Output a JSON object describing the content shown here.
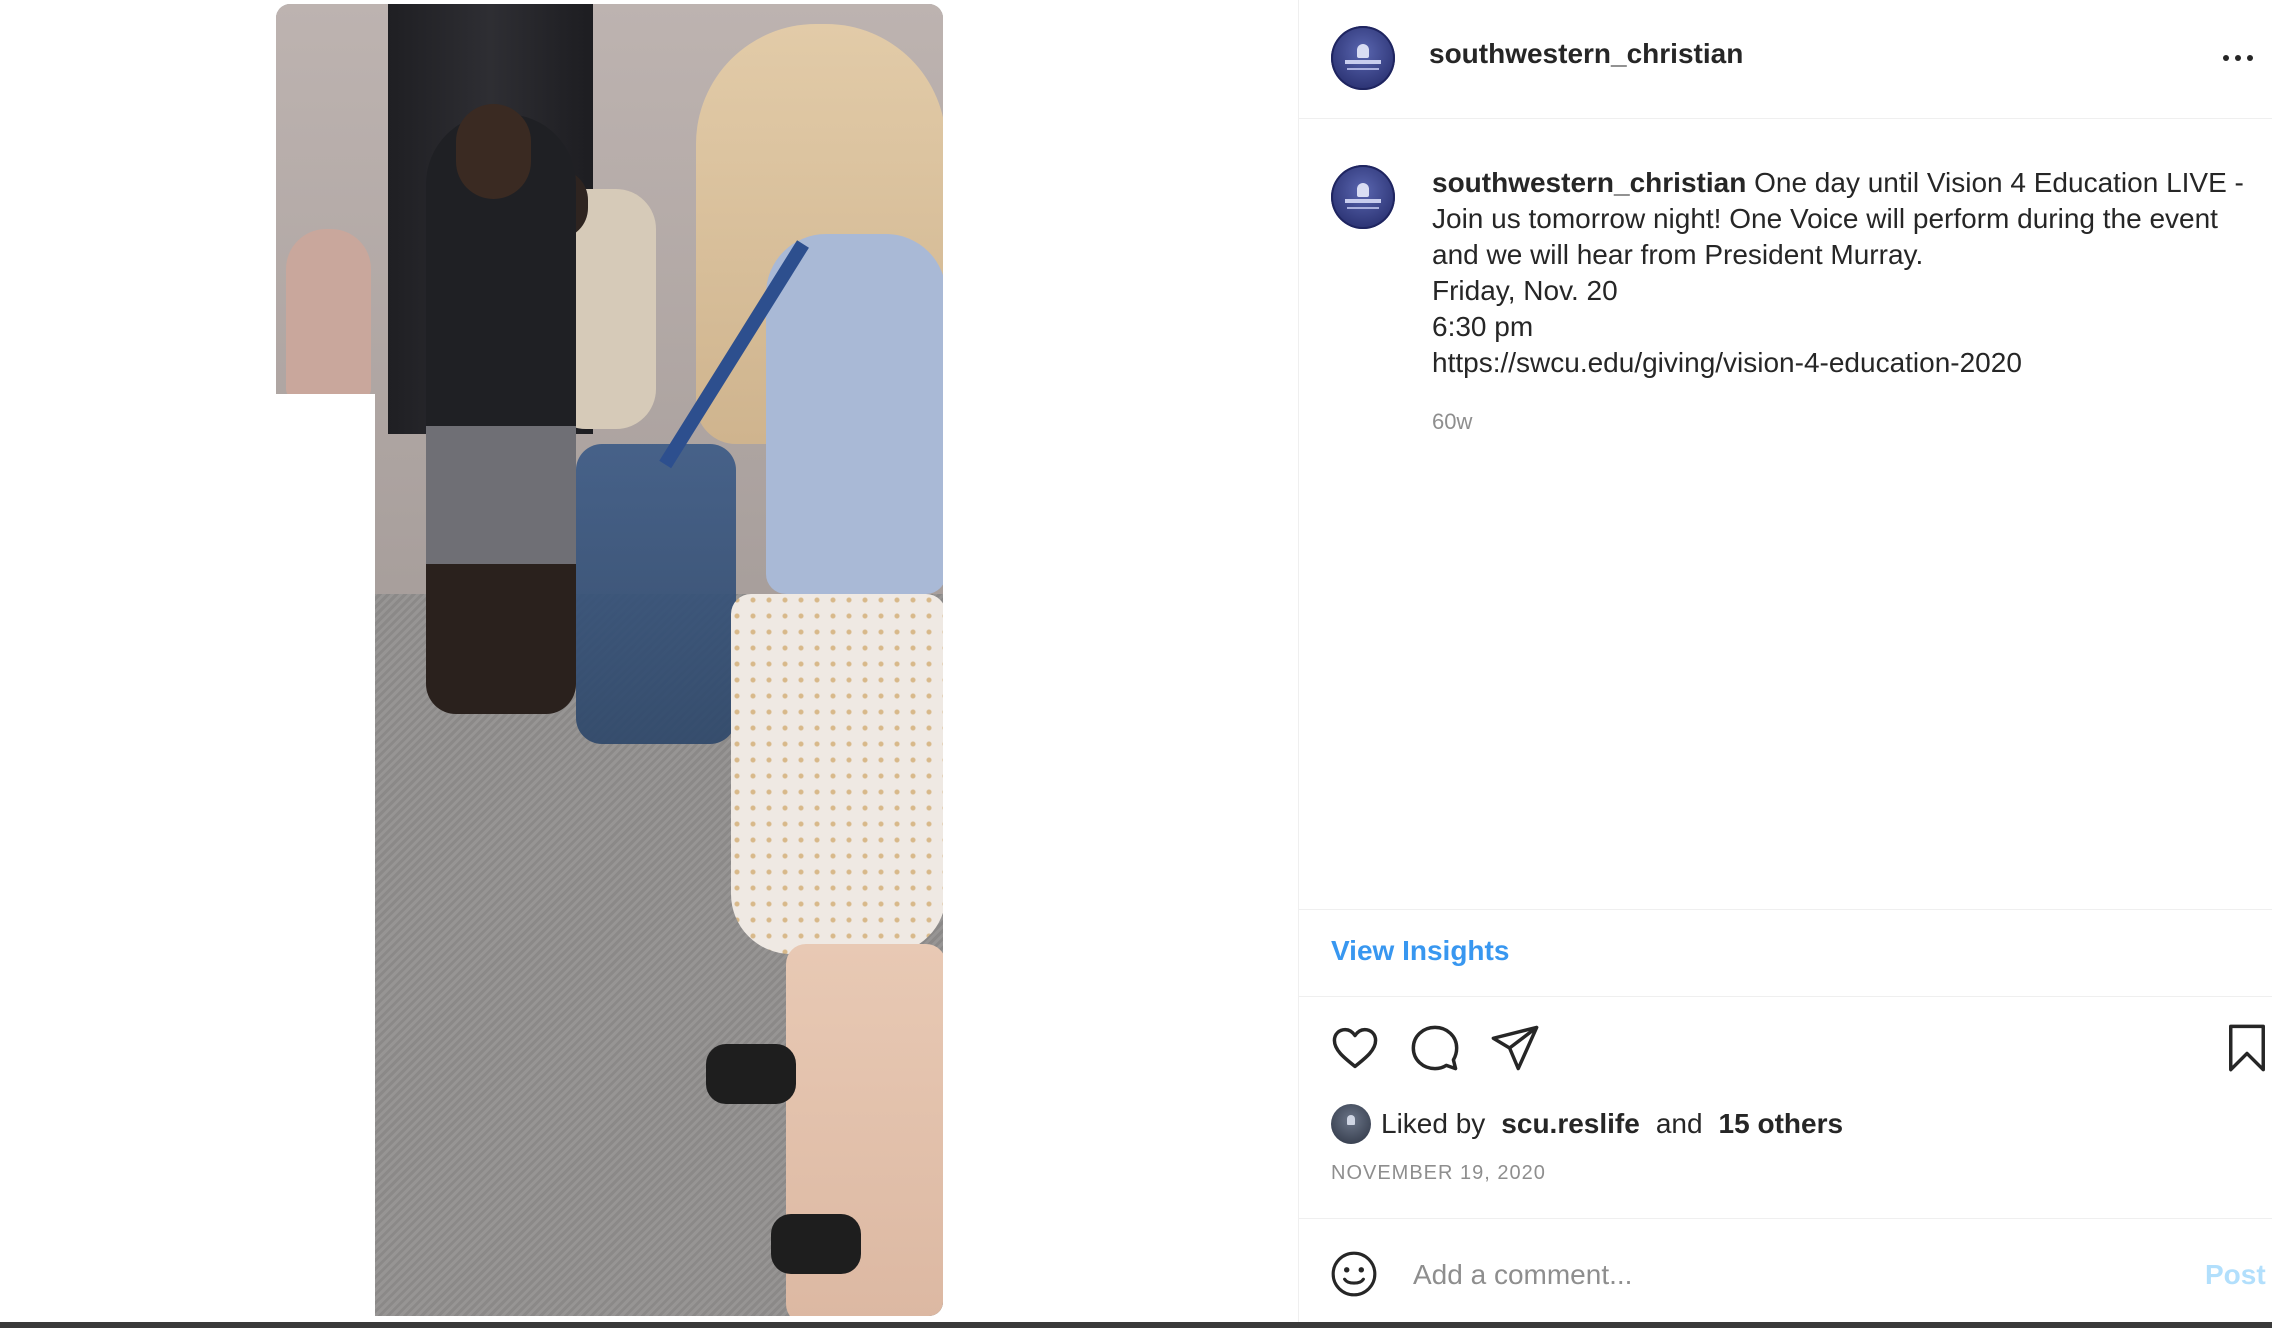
{
  "post": {
    "username": "southwestern_christian",
    "caption_lines": [
      "One day until Vision 4 Education LIVE -",
      "Join us tomorrow night! One Voice will perform during the event",
      "and we will hear from President Murray.",
      "Friday, Nov. 20",
      "6:30 pm",
      "https://swcu.edu/giving/vision-4-education-2020"
    ],
    "time_ago": "60w",
    "insights_label": "View Insights",
    "likes": {
      "prefix": "Liked by",
      "liker": "scu.reslife",
      "and": "and",
      "others": "15 others"
    },
    "date": "NOVEMBER 19, 2020"
  },
  "comment": {
    "placeholder": "Add a comment...",
    "post_label": "Post"
  },
  "icons": {
    "more": "more-options-icon",
    "like": "heart-icon",
    "comment": "comment-bubble-icon",
    "share": "paper-plane-icon",
    "save": "bookmark-icon",
    "emoji": "smiley-icon"
  },
  "colors": {
    "link_blue": "#3897f0",
    "post_disabled": "#b2dffc",
    "muted_text": "#8e8e8e",
    "avatar_navy": "#2f3778"
  }
}
